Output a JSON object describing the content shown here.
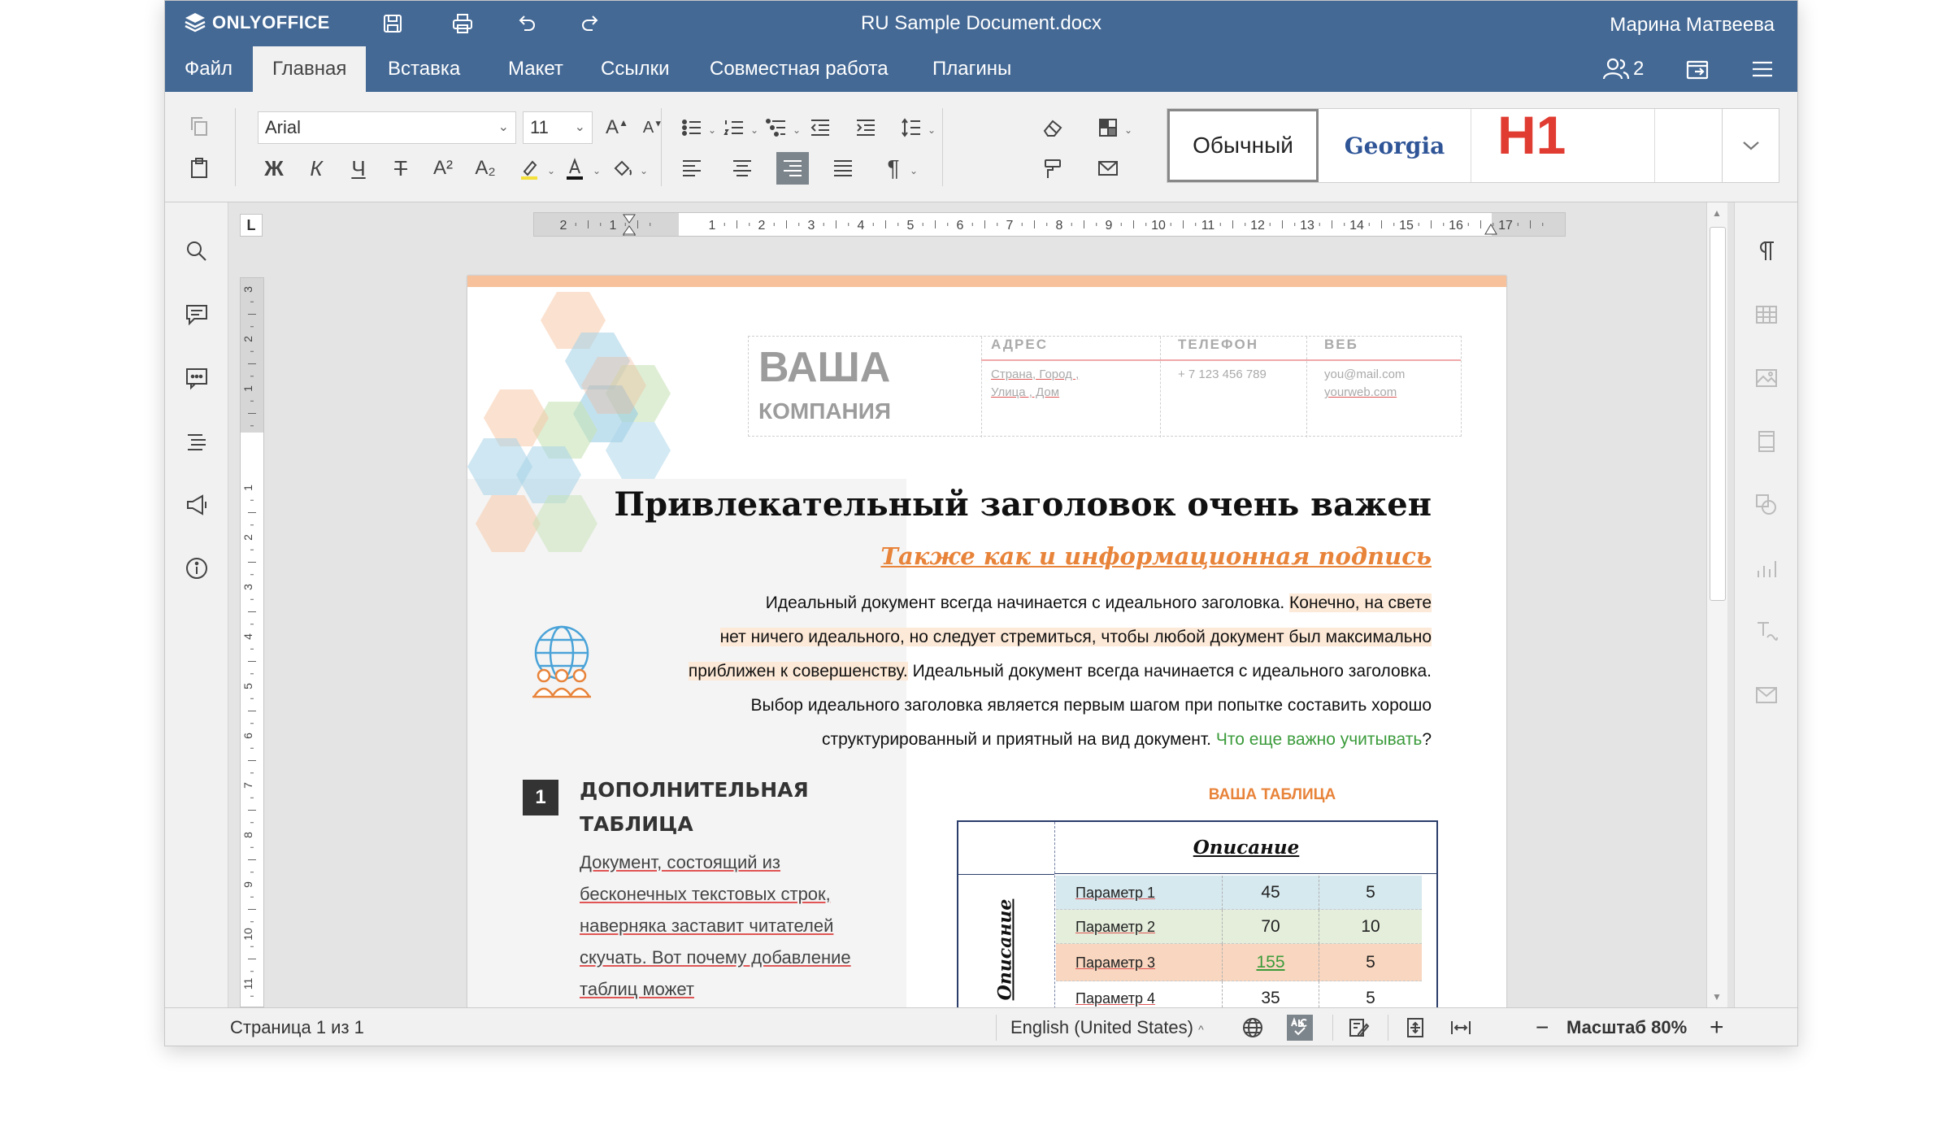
{
  "app": {
    "logo": "ONLYOFFICE",
    "document_title": "RU Sample Document.docx",
    "user_name": "Марина Матвеева",
    "users_count": "2"
  },
  "menu": {
    "tabs": [
      {
        "label": "Файл"
      },
      {
        "label": "Главная"
      },
      {
        "label": "Вставка"
      },
      {
        "label": "Макет"
      },
      {
        "label": "Ссылки"
      },
      {
        "label": "Совместная работа"
      },
      {
        "label": "Плагины"
      }
    ],
    "active_tab": "Главная"
  },
  "toolbar": {
    "font_name": "Arial",
    "font_size": "11",
    "bold": "Ж",
    "italic": "К",
    "underline": "Ч",
    "strike": "Т",
    "superscript": "A²",
    "subscript": "A₂",
    "paragraph_mark": "¶",
    "styles": [
      {
        "label": "Обычный"
      },
      {
        "label": "Georgia"
      },
      {
        "label": "H1"
      }
    ],
    "style_colors": {
      "georgia": "#2f5597",
      "h1": "#e03c31"
    }
  },
  "ruler": {
    "horizontal_ticks": [
      "2",
      "1",
      "1",
      "2",
      "3",
      "4",
      "5",
      "6",
      "7",
      "8",
      "9",
      "10",
      "11",
      "12",
      "13",
      "14",
      "15",
      "16",
      "17"
    ],
    "vertical_ticks": [
      "3",
      "2",
      "1",
      "1",
      "2",
      "3",
      "4",
      "5",
      "6",
      "7",
      "8",
      "9",
      "10",
      "11"
    ],
    "corner": "L"
  },
  "document": {
    "company_name": "ВАША",
    "company_sub": "КОМПАНИЯ",
    "address_label": "АДРЕС",
    "address_value_1": "Страна,  Город ,",
    "address_value_2": "Улица , Дом",
    "phone_label": "ТЕЛЕФОН",
    "phone_value": "+ 7 123 456 789",
    "web_label": "ВЕБ",
    "web_value_1": "you@mail.com",
    "web_value_2": "yourweb.com",
    "headline": "Привлекательный заголовок очень важен",
    "subline": "Также как и информационная подпись",
    "para_line1_a": "Идеальный документ всегда начинается с идеального заголовка. ",
    "para_line1_b": "Конечно, на свете",
    "para_line2": "нет ничего идеального, но следует стремиться, чтобы любой документ был максимально",
    "para_line3_a": "приближен к совершенству.",
    "para_line3_b": " Идеальный документ всегда начинается с идеального заголовка.",
    "para_line4": "Выбор идеального заголовка является первым шагом при попытке составить хорошо",
    "para_line5_a": "структурированный и приятный на вид документ. ",
    "para_line5_b": "Что еще важно учитывать",
    "para_line5_c": "?",
    "section_number": "1",
    "section_title": "ДОПОЛНИТЕЛЬНАЯ ТАБЛИЦА",
    "section_text": "Документ, состоящий из бесконечных текстовых строк, наверняка заставит читателей скучать. Вот почему добавление таблиц может",
    "table_title": "ВАША ТАБЛИЦА",
    "table_header": "Описание",
    "table_side_label": "Описание",
    "table_rows": [
      {
        "param": "Параметр 1",
        "v1": "45",
        "v2": "5",
        "color": "#d6e9ef"
      },
      {
        "param": "Параметр 2",
        "v1": "70",
        "v2": "10",
        "color": "#e4eedb"
      },
      {
        "param": "Параметр 3",
        "v1": "155",
        "v2": "5",
        "color": "#f9d6bf"
      },
      {
        "param": "Параметр 4",
        "v1": "35",
        "v2": "5",
        "color": "#ffffff"
      }
    ]
  },
  "statusbar": {
    "page_info": "Страница 1 из 1",
    "language": "English (United States)",
    "zoom_label": "Масштаб 80%"
  },
  "colors": {
    "header_bg": "#446995",
    "accent_orange": "#e8833a",
    "table_border": "#2b3d6b"
  }
}
